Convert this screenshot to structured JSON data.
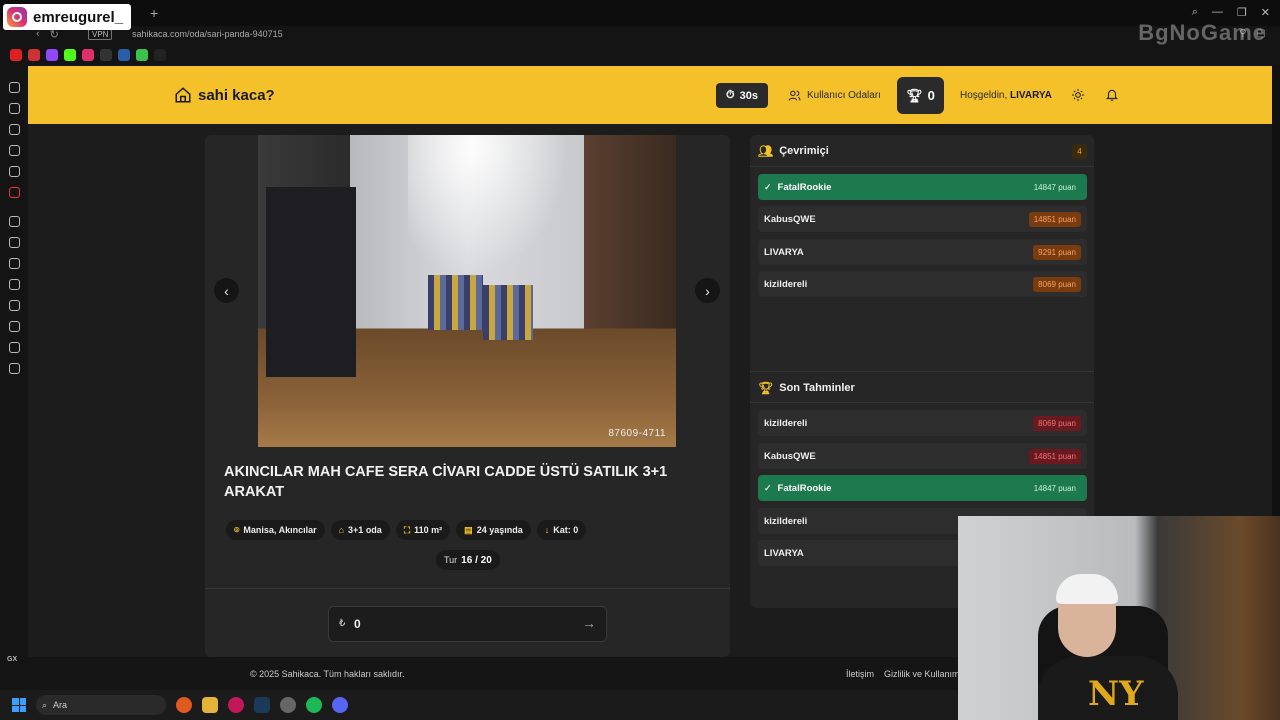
{
  "browser": {
    "url": "sahikaca.com/oda/sari-panda-940715",
    "vpn_label": "VPN"
  },
  "overlay": {
    "instagram_handle": "emreugurel_",
    "watermark": "BgNoGame"
  },
  "header": {
    "logo_text": "sahi kaca?",
    "timer": "30s",
    "rooms_label": "Kullanıcı Odaları",
    "score": "0",
    "welcome_prefix": "Hoşgeldin,",
    "username": "LIVARYA"
  },
  "listing": {
    "photo_code": "87609-4711",
    "title": "AKINCILAR MAH CAFE SERA CİVARI CADDE ÜSTÜ SATILIK 3+1 ARAKAT",
    "tags": [
      {
        "icon": "location-icon",
        "label": "Manisa, Akıncılar"
      },
      {
        "icon": "home-icon",
        "label": "3+1 oda"
      },
      {
        "icon": "expand-icon",
        "label": "110 m²"
      },
      {
        "icon": "building-icon",
        "label": "24 yaşında"
      },
      {
        "icon": "arrow-down-icon",
        "label": "Kat: 0"
      }
    ],
    "round_label": "Tur",
    "round_value": "16 / 20",
    "currency": "₺",
    "guess_value": "0"
  },
  "online": {
    "title": "Çevrimiçi",
    "count": "4",
    "users": [
      {
        "name": "FatalRookie",
        "points": "14847 puan",
        "highlight": true
      },
      {
        "name": "KabusQWE",
        "points": "14851 puan",
        "highlight": false
      },
      {
        "name": "LIVARYA",
        "points": "9291 puan",
        "highlight": false
      },
      {
        "name": "kizildereli",
        "points": "8069 puan",
        "highlight": false
      }
    ]
  },
  "recent": {
    "title": "Son Tahminler",
    "items": [
      {
        "name": "kizildereli",
        "points": "8069 puan",
        "highlight": false
      },
      {
        "name": "KabusQWE",
        "points": "14851 puan",
        "highlight": false
      },
      {
        "name": "FatalRookie",
        "points": "14847 puan",
        "highlight": true
      },
      {
        "name": "kizildereli",
        "points": "",
        "highlight": false
      },
      {
        "name": "LIVARYA",
        "points": "",
        "highlight": false
      }
    ]
  },
  "footer": {
    "copyright": "© 2025 Sahikaca. Tüm hakları saklıdır.",
    "contact": "İletişim",
    "privacy": "Gizlilik ve Kullanım"
  },
  "taskbar": {
    "search_label": "Ara"
  },
  "colors": {
    "accent": "#f5c12a",
    "highlight_row": "#1d7a4f"
  }
}
